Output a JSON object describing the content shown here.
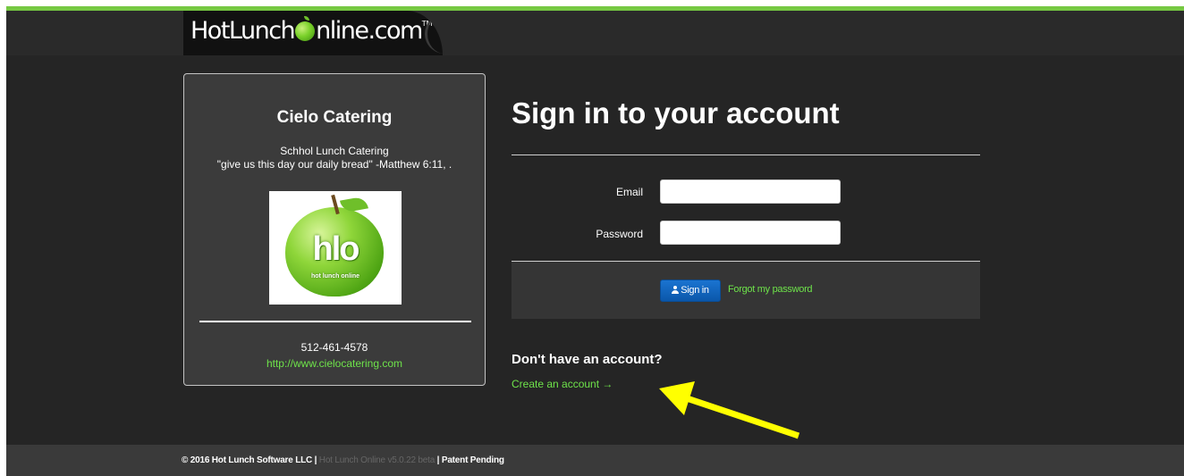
{
  "header": {
    "logo_prefix": "HotLunch",
    "logo_suffix": "nline.com",
    "logo_tm": "TM"
  },
  "caterer": {
    "name": "Cielo Catering",
    "description_line1": "Schhol Lunch Catering",
    "description_line2": "\"give us this day our daily bread\" -Matthew 6:11, .",
    "logo_big_text": "hlo",
    "logo_small_text": "hot lunch online",
    "phone": "512-461-4578",
    "website": "http://www.cielocatering.com"
  },
  "signin": {
    "title": "Sign in to your account",
    "email_label": "Email",
    "email_value": "",
    "password_label": "Password",
    "password_value": "",
    "signin_button": "Sign in",
    "forgot_link": "Forgot my password",
    "no_account_heading": "Don't have an account?",
    "create_account_link": "Create an account →"
  },
  "footer": {
    "copyright": "© 2016 Hot Lunch Software LLC | ",
    "version": "Hot Lunch Online v5.0.22 beta",
    "patent": " | Patent Pending"
  },
  "colors": {
    "accent_green": "#6ee34a",
    "top_bar_green": "#76c842",
    "button_blue": "#0b57aa",
    "annotation_arrow": "#ffff00"
  },
  "icons": {
    "signin_button_icon": "user-icon"
  }
}
